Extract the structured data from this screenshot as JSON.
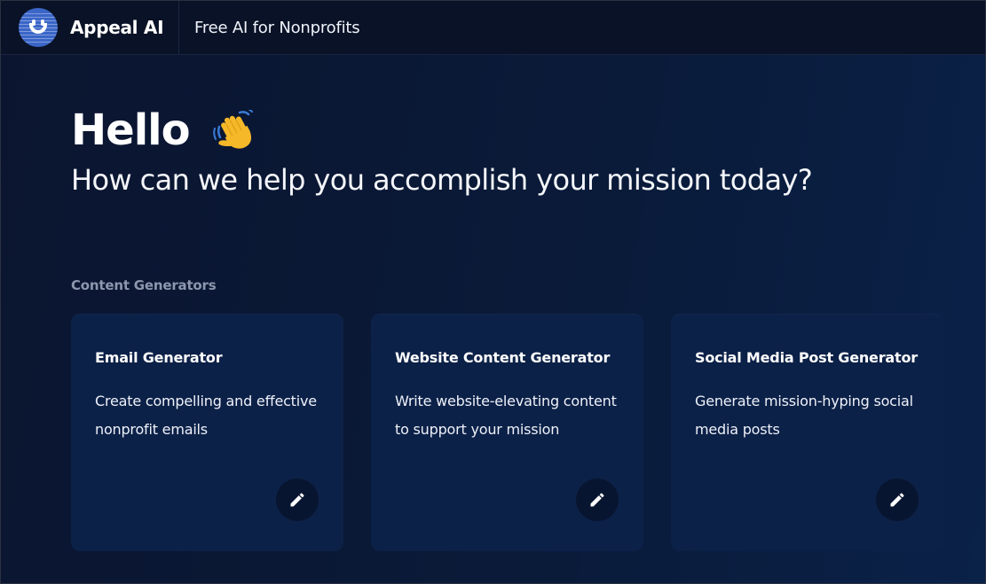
{
  "header": {
    "brand_name": "Appeal AI",
    "tagline": "Free AI for Nonprofits",
    "logo_icon": "smiley-logo-icon"
  },
  "hero": {
    "greeting": "Hello",
    "greeting_icon": "waving-hand-icon",
    "subtitle": "How can we help you accomplish your mission today?"
  },
  "section": {
    "label": "Content Generators"
  },
  "cards": [
    {
      "title": "Email Generator",
      "description": "Create compelling and effective nonprofit emails",
      "action_icon": "pencil-icon"
    },
    {
      "title": "Website Content Generator",
      "description": "Write website-elevating content to support your mission",
      "action_icon": "pencil-icon"
    },
    {
      "title": "Social Media Post Generator",
      "description": "Generate mission-hyping social media posts",
      "action_icon": "pencil-icon"
    }
  ],
  "colors": {
    "background": "#0b1530",
    "header_background": "#091226",
    "card_background": "#0c2148",
    "logo_blue": "#3b66c8",
    "muted_text": "#8c97ad"
  }
}
